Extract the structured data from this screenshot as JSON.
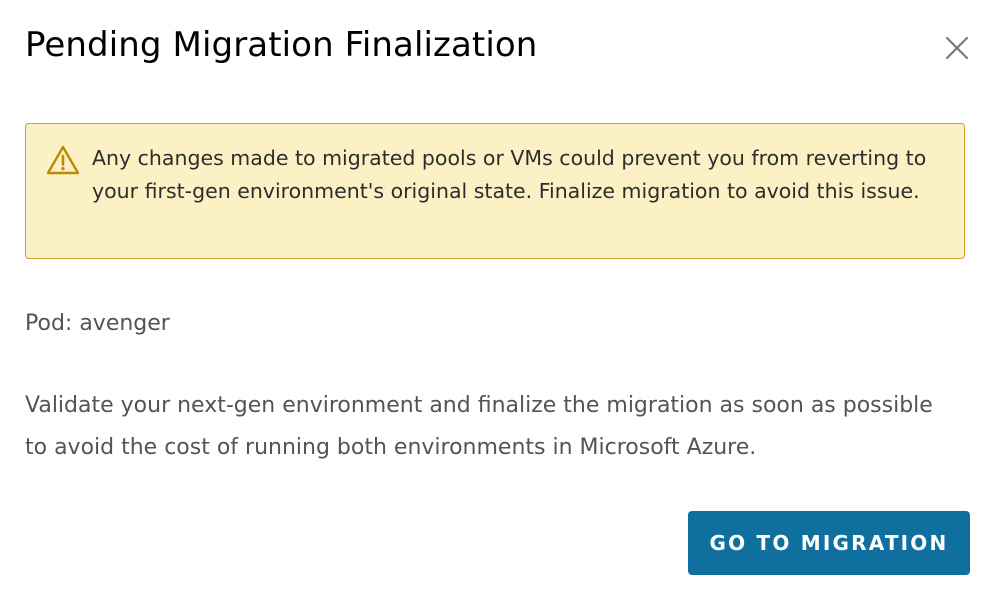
{
  "dialog": {
    "title": "Pending Migration Finalization",
    "close_icon": "close-icon",
    "alert": {
      "type": "warning",
      "icon": "warning-triangle-icon",
      "message": "Any changes made to migrated pools or VMs could prevent you from reverting to your first-gen environment's original state. Finalize migration to avoid this issue."
    },
    "pod_label": "Pod: avenger",
    "description": "Validate your next-gen environment and finalize the migration as soon as possible to avoid the cost of running both environments in Microsoft Azure.",
    "primary_button_label": "GO TO MIGRATION"
  },
  "colors": {
    "alert_background": "#fcf1c5",
    "alert_border": "#c9a230",
    "alert_icon": "#c08a00",
    "primary_button": "#0f6f9e",
    "primary_button_text": "#ffffff",
    "body_text": "#545454",
    "title_text": "#000000"
  }
}
